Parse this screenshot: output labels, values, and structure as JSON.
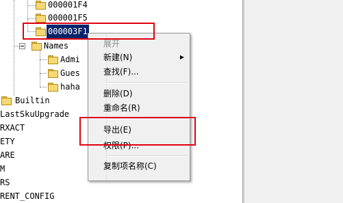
{
  "tree": {
    "items": [
      {
        "label": "000001F4"
      },
      {
        "label": "000001F5"
      },
      {
        "label": "000003F1"
      },
      {
        "label": "Names"
      },
      {
        "label": "Admi"
      },
      {
        "label": "Gues"
      },
      {
        "label": "haha"
      },
      {
        "label": "Builtin"
      },
      {
        "label": "LastSkuUpgrade"
      },
      {
        "label": "RXACT"
      },
      {
        "label": "ETY"
      },
      {
        "label": "ARE"
      },
      {
        "label": "M"
      },
      {
        "label": "RS"
      },
      {
        "label": "RENT_CONFIG"
      }
    ]
  },
  "context_menu": {
    "items": [
      {
        "label": "展开",
        "disabled": true
      },
      {
        "label": "新建(N)",
        "submenu": true
      },
      {
        "label": "查找(F)..."
      },
      {
        "label": "删除(D)"
      },
      {
        "label": "重命名(R)"
      },
      {
        "label": "导出(E)"
      },
      {
        "label": "权限(P)..."
      },
      {
        "label": "复制项名称(C)"
      }
    ],
    "submenu_arrow": "▶"
  },
  "highlight_color": "#e00010",
  "selection_color": "#0a246a"
}
